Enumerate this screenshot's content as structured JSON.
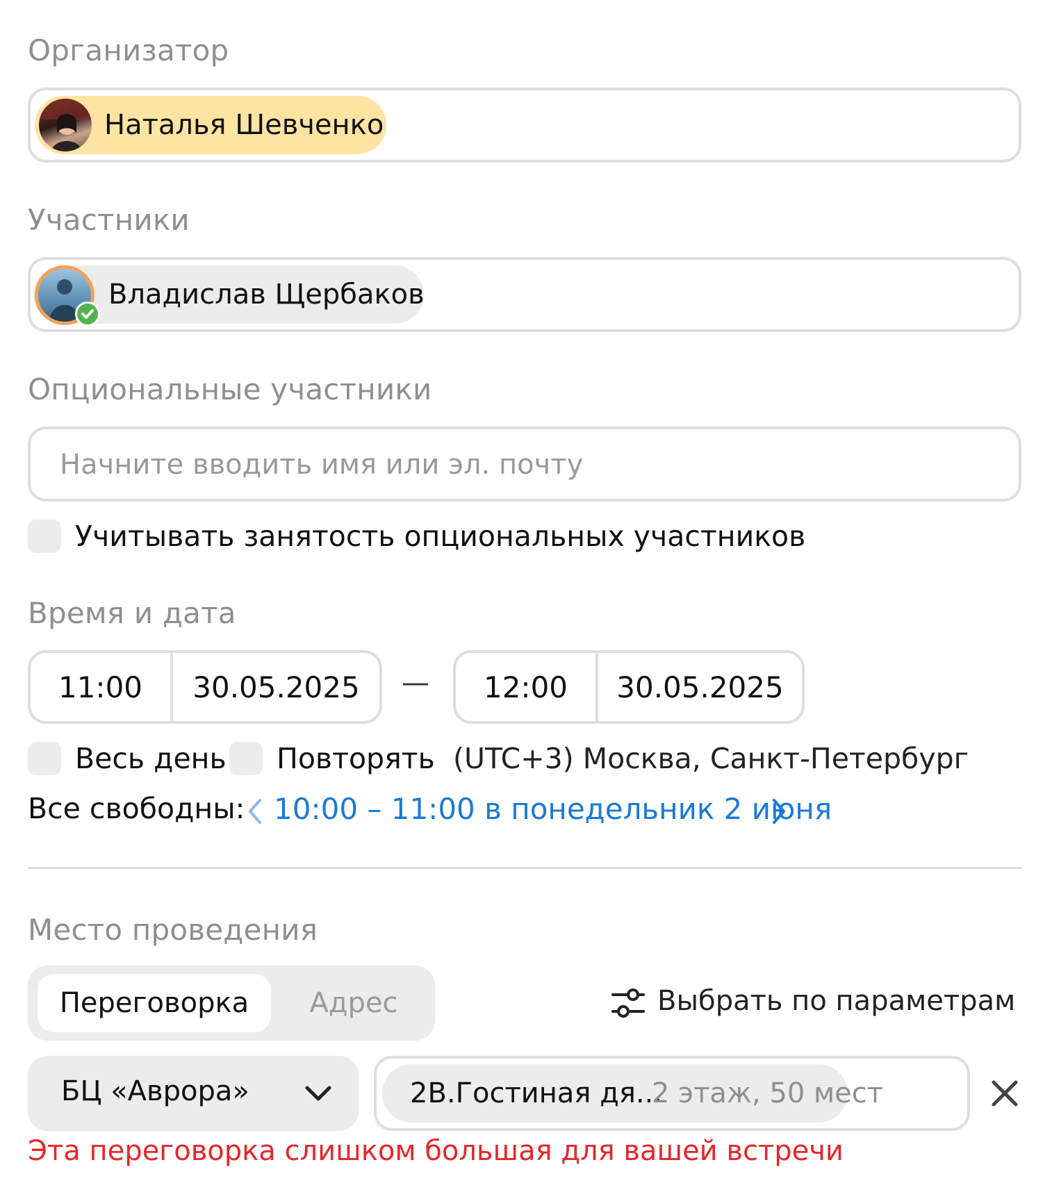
{
  "organizer": {
    "label": "Организатор",
    "person": {
      "name": "Наталья Шевченко",
      "avatar_icon": "person-photo-icon",
      "chip_color": "#fde4a3"
    }
  },
  "participants": {
    "label": "Участники",
    "people": [
      {
        "name": "Владислав Щербаков",
        "avatar_icon": "person-photo-icon",
        "status_icon": "check-circle-icon",
        "status_color": "#55b24f"
      }
    ]
  },
  "optional_participants": {
    "label": "Опциональные участники",
    "placeholder": "Начните вводить имя или эл. почту",
    "consider_busy_label": "Учитывать занятость опциональных участников"
  },
  "datetime": {
    "label": "Время и дата",
    "start_time": "11:00",
    "start_date": "30.05.2025",
    "separator": "—",
    "end_time": "12:00",
    "end_date": "30.05.2025",
    "all_day_label": "Весь день",
    "repeat_label": "Повторять",
    "timezone": "(UTC+3) Москва, Санкт-Петербург",
    "all_free_label": "Все свободны:",
    "free_slot": "10:00 – 11:00 в понедельник 2 июня",
    "prev_icon": "chevron-left-icon",
    "next_icon": "chevron-right-icon"
  },
  "location": {
    "label": "Место проведения",
    "tabs": [
      {
        "label": "Переговорка",
        "active": true
      },
      {
        "label": "Адрес",
        "active": false
      }
    ],
    "filter_icon": "sliders-icon",
    "select_by_params": "Выбрать по параметрам",
    "building": "БЦ «Аврора»",
    "building_dropdown_icon": "chevron-down-icon",
    "room_name": "2В.Гостиная дя...",
    "room_details": "2 этаж, 50 мест",
    "remove_icon": "close-icon",
    "warning": "Эта переговорка слишком большая для вашей встречи",
    "warning_color": "#e8262a"
  }
}
